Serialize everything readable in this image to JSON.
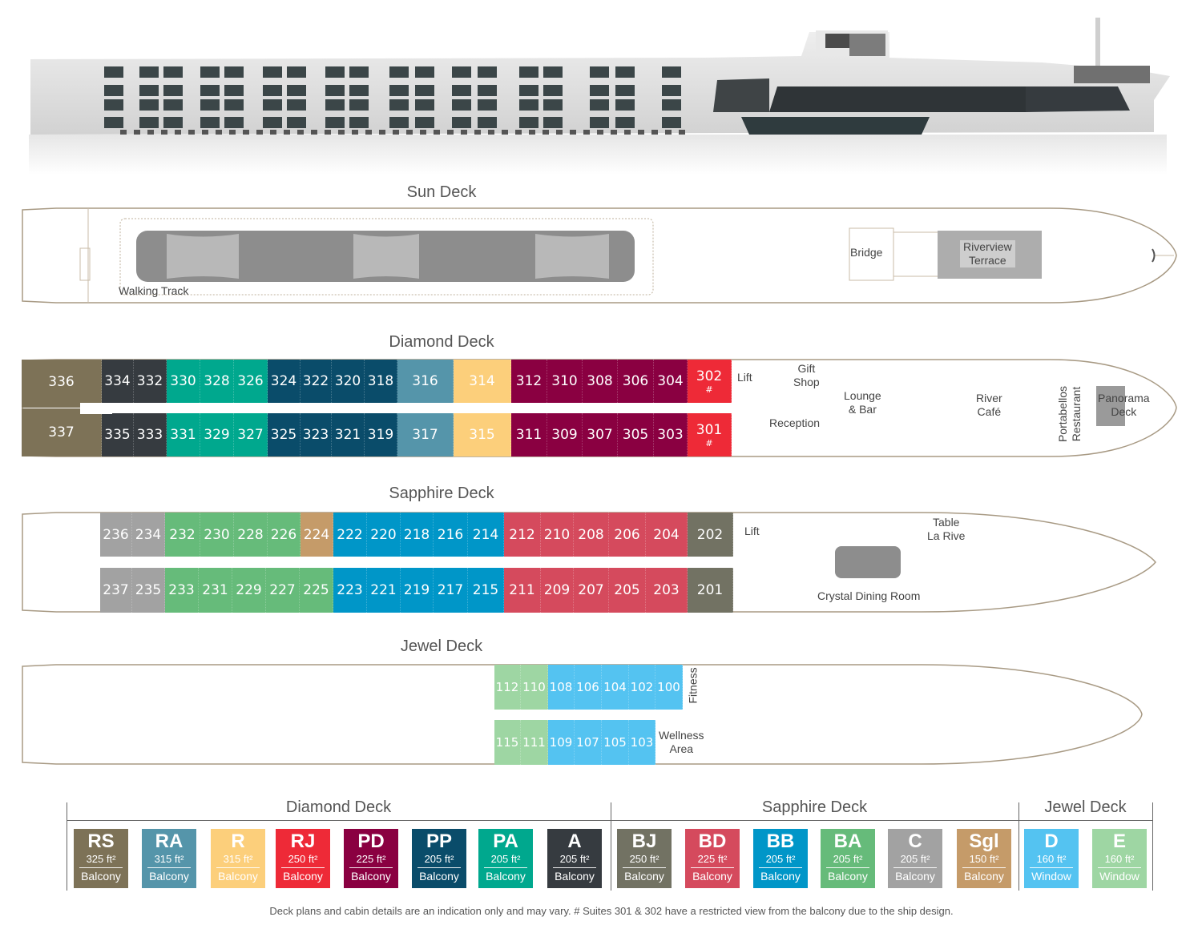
{
  "colors": {
    "RS": "#7d7257",
    "RA": "#5595aa",
    "R": "#fccf7b",
    "RJ": "#ee2a37",
    "PD": "#8a0041",
    "PP": "#0a4c6a",
    "PA": "#00a88e",
    "A": "#363b40",
    "BJ": "#727263",
    "BD": "#d54a5d",
    "BB": "#0096c8",
    "BA": "#66bb7a",
    "C": "#a2a2a2",
    "Sgl": "#c59b69",
    "D": "#54c3f1",
    "E": "#9ed6a3",
    "hull_line": "#a89a84",
    "dark_area": "#8d8d8d"
  },
  "decks": {
    "sun": {
      "title": "Sun Deck",
      "labels": {
        "walking_track": "Walking Track",
        "bridge": "Bridge",
        "terrace": "Riverview\nTerrace"
      }
    },
    "diamond": {
      "title": "Diamond Deck",
      "top_row": [
        {
          "num": "336",
          "cat": "RS"
        },
        {
          "num": "334",
          "cat": "A"
        },
        {
          "num": "332",
          "cat": "A"
        },
        {
          "num": "330",
          "cat": "PA"
        },
        {
          "num": "328",
          "cat": "PA"
        },
        {
          "num": "326",
          "cat": "PA"
        },
        {
          "num": "324",
          "cat": "PP"
        },
        {
          "num": "322",
          "cat": "PP"
        },
        {
          "num": "320",
          "cat": "PP"
        },
        {
          "num": "318",
          "cat": "PP"
        },
        {
          "num": "316",
          "cat": "RA"
        },
        {
          "num": "314",
          "cat": "R"
        },
        {
          "num": "312",
          "cat": "PD"
        },
        {
          "num": "310",
          "cat": "PD"
        },
        {
          "num": "308",
          "cat": "PD"
        },
        {
          "num": "306",
          "cat": "PD"
        },
        {
          "num": "304",
          "cat": "PD"
        },
        {
          "num": "302",
          "cat": "RJ",
          "mark": "#"
        }
      ],
      "bottom_row": [
        {
          "num": "337",
          "cat": "RS"
        },
        {
          "num": "335",
          "cat": "A"
        },
        {
          "num": "333",
          "cat": "A"
        },
        {
          "num": "331",
          "cat": "PA"
        },
        {
          "num": "329",
          "cat": "PA"
        },
        {
          "num": "327",
          "cat": "PA"
        },
        {
          "num": "325",
          "cat": "PP"
        },
        {
          "num": "323",
          "cat": "PP"
        },
        {
          "num": "321",
          "cat": "PP"
        },
        {
          "num": "319",
          "cat": "PP"
        },
        {
          "num": "317",
          "cat": "RA"
        },
        {
          "num": "315",
          "cat": "R"
        },
        {
          "num": "311",
          "cat": "PD"
        },
        {
          "num": "309",
          "cat": "PD"
        },
        {
          "num": "307",
          "cat": "PD"
        },
        {
          "num": "305",
          "cat": "PD"
        },
        {
          "num": "303",
          "cat": "PD"
        },
        {
          "num": "301",
          "cat": "RJ",
          "mark": "#"
        }
      ],
      "labels": {
        "lift": "Lift",
        "gift_shop": "Gift\nShop",
        "reception": "Reception",
        "lounge": "Lounge\n& Bar",
        "river_cafe": "River\nCafé",
        "portabellos": "Portabellos\nRestaurant",
        "panorama": "Panorama\nDeck"
      }
    },
    "sapphire": {
      "title": "Sapphire Deck",
      "top_row": [
        {
          "num": "236",
          "cat": "C"
        },
        {
          "num": "234",
          "cat": "C"
        },
        {
          "num": "232",
          "cat": "BA"
        },
        {
          "num": "230",
          "cat": "BA"
        },
        {
          "num": "228",
          "cat": "BA"
        },
        {
          "num": "226",
          "cat": "BA"
        },
        {
          "num": "224",
          "cat": "Sgl"
        },
        {
          "num": "222",
          "cat": "BB"
        },
        {
          "num": "220",
          "cat": "BB"
        },
        {
          "num": "218",
          "cat": "BB"
        },
        {
          "num": "216",
          "cat": "BB"
        },
        {
          "num": "214",
          "cat": "BB"
        },
        {
          "num": "212",
          "cat": "BD"
        },
        {
          "num": "210",
          "cat": "BD"
        },
        {
          "num": "208",
          "cat": "BD"
        },
        {
          "num": "206",
          "cat": "BD"
        },
        {
          "num": "204",
          "cat": "BD"
        },
        {
          "num": "202",
          "cat": "BJ"
        }
      ],
      "bottom_row": [
        {
          "num": "237",
          "cat": "C"
        },
        {
          "num": "235",
          "cat": "C"
        },
        {
          "num": "233",
          "cat": "BA"
        },
        {
          "num": "231",
          "cat": "BA"
        },
        {
          "num": "229",
          "cat": "BA"
        },
        {
          "num": "227",
          "cat": "BA"
        },
        {
          "num": "225",
          "cat": "BA"
        },
        {
          "num": "223",
          "cat": "BB"
        },
        {
          "num": "221",
          "cat": "BB"
        },
        {
          "num": "219",
          "cat": "BB"
        },
        {
          "num": "217",
          "cat": "BB"
        },
        {
          "num": "215",
          "cat": "BB"
        },
        {
          "num": "211",
          "cat": "BD"
        },
        {
          "num": "209",
          "cat": "BD"
        },
        {
          "num": "207",
          "cat": "BD"
        },
        {
          "num": "205",
          "cat": "BD"
        },
        {
          "num": "203",
          "cat": "BD"
        },
        {
          "num": "201",
          "cat": "BJ"
        }
      ],
      "labels": {
        "lift": "Lift",
        "table_la_rive": "Table\nLa Rive",
        "crystal": "Crystal Dining Room"
      }
    },
    "jewel": {
      "title": "Jewel Deck",
      "top_row": [
        {
          "num": "112",
          "cat": "E"
        },
        {
          "num": "110",
          "cat": "E"
        },
        {
          "num": "108",
          "cat": "D"
        },
        {
          "num": "106",
          "cat": "D"
        },
        {
          "num": "104",
          "cat": "D"
        },
        {
          "num": "102",
          "cat": "D"
        },
        {
          "num": "100",
          "cat": "D"
        }
      ],
      "bottom_row": [
        {
          "num": "115",
          "cat": "E"
        },
        {
          "num": "111",
          "cat": "E"
        },
        {
          "num": "109",
          "cat": "D"
        },
        {
          "num": "107",
          "cat": "D"
        },
        {
          "num": "105",
          "cat": "D"
        },
        {
          "num": "103",
          "cat": "D"
        }
      ],
      "labels": {
        "fitness": "Fitness",
        "wellness": "Wellness\nArea"
      }
    }
  },
  "legend": {
    "groups": [
      {
        "title": "Diamond Deck",
        "items": [
          {
            "code": "RS",
            "size": "325 ft²",
            "view": "Balcony"
          },
          {
            "code": "RA",
            "size": "315 ft²",
            "view": "Balcony"
          },
          {
            "code": "R",
            "size": "315 ft²",
            "view": "Balcony"
          },
          {
            "code": "RJ",
            "size": "250 ft²",
            "view": "Balcony"
          },
          {
            "code": "PD",
            "size": "225 ft²",
            "view": "Balcony"
          },
          {
            "code": "PP",
            "size": "205 ft²",
            "view": "Balcony"
          },
          {
            "code": "PA",
            "size": "205 ft²",
            "view": "Balcony"
          },
          {
            "code": "A",
            "size": "205 ft²",
            "view": "Balcony"
          }
        ]
      },
      {
        "title": "Sapphire Deck",
        "items": [
          {
            "code": "BJ",
            "size": "250 ft²",
            "view": "Balcony"
          },
          {
            "code": "BD",
            "size": "225 ft²",
            "view": "Balcony"
          },
          {
            "code": "BB",
            "size": "205 ft²",
            "view": "Balcony"
          },
          {
            "code": "BA",
            "size": "205 ft²",
            "view": "Balcony"
          },
          {
            "code": "C",
            "size": "205 ft²",
            "view": "Balcony"
          },
          {
            "code": "Sgl",
            "size": "150 ft²",
            "view": "Balcony"
          }
        ]
      },
      {
        "title": "Jewel Deck",
        "items": [
          {
            "code": "D",
            "size": "160 ft²",
            "view": "Window"
          },
          {
            "code": "E",
            "size": "160 ft²",
            "view": "Window"
          }
        ]
      }
    ]
  },
  "footnote": "Deck plans and cabin details are an indication only and may vary.  # Suites 301 & 302 have a restricted view from the balcony due to the ship design."
}
